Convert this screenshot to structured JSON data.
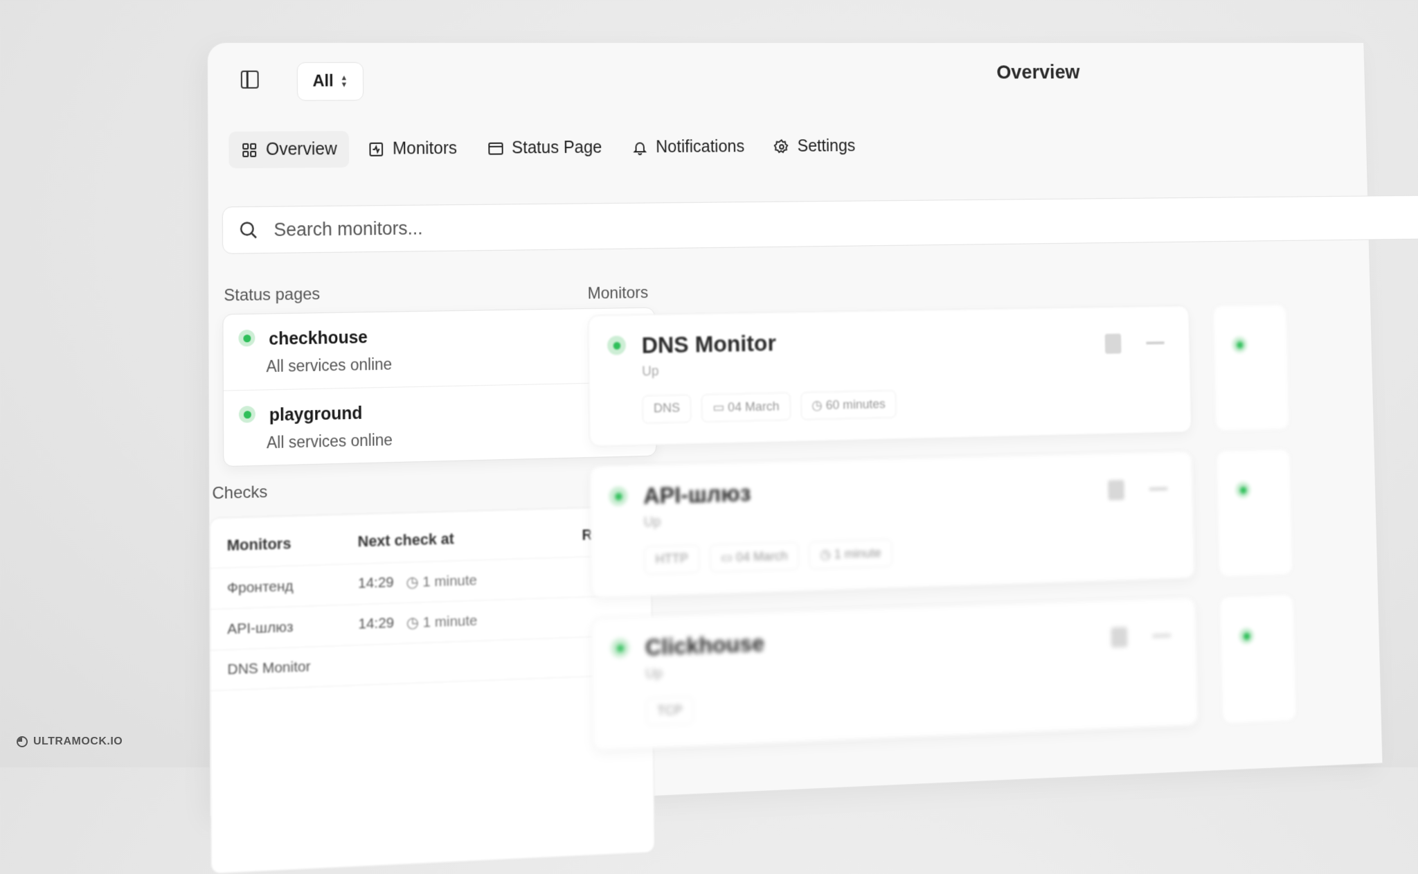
{
  "topbar": {
    "scope_value": "All",
    "page_title": "Overview"
  },
  "tabs": [
    {
      "label": "Overview",
      "icon": "grid-icon",
      "active": true
    },
    {
      "label": "Monitors",
      "icon": "pulse-icon",
      "active": false
    },
    {
      "label": "Status Page",
      "icon": "window-icon",
      "active": false
    },
    {
      "label": "Notifications",
      "icon": "bell-icon",
      "active": false
    },
    {
      "label": "Settings",
      "icon": "gear-icon",
      "active": false
    }
  ],
  "search": {
    "placeholder": "Search monitors..."
  },
  "status_pages": {
    "label": "Status pages",
    "items": [
      {
        "name": "checkhouse",
        "status": "All services online"
      },
      {
        "name": "playground",
        "status": "All services online"
      }
    ]
  },
  "checks": {
    "label": "Checks",
    "headers": [
      "Monitors",
      "Next check at",
      "Results"
    ],
    "rows": [
      {
        "monitor": "Фронтенд",
        "time": "14:29",
        "interval": "1 minute"
      },
      {
        "monitor": "API-шлюз",
        "time": "14:29",
        "interval": "1 minute"
      },
      {
        "monitor": "DNS Monitor",
        "time": "",
        "interval": ""
      }
    ]
  },
  "monitors": {
    "label": "Monitors",
    "items": [
      {
        "name": "DNS Monitor",
        "state": "Up",
        "type": "DNS",
        "date": "04 March",
        "interval": "60 minutes"
      },
      {
        "name": "API-шлюз",
        "state": "Up",
        "type": "HTTP",
        "date": "04 March",
        "interval": "1 minute"
      },
      {
        "name": "Clickhouse",
        "state": "Up",
        "type": "TCP",
        "date": "",
        "interval": ""
      }
    ]
  },
  "watermark": "ULTRAMOCK.IO",
  "colors": {
    "status_green": "#2fbf5a",
    "status_green_soft": "#cdeed5"
  }
}
